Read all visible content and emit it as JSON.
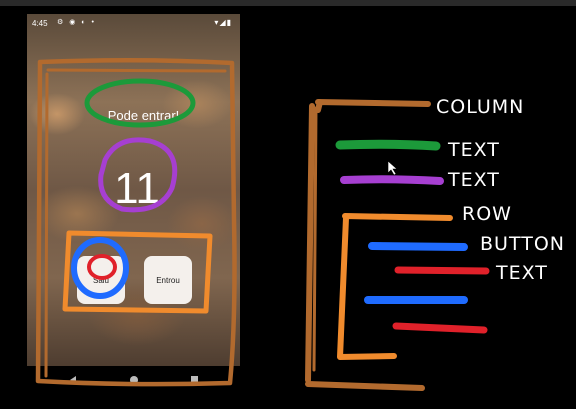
{
  "status_bar": {
    "time": "4:45"
  },
  "app": {
    "title": "Pode entrar!",
    "counter": "11",
    "buttons": {
      "left_label": "Saiu",
      "right_label": "Entrou"
    }
  },
  "annotations": {
    "labels": [
      "COLUMN",
      "TEXT",
      "TEXT",
      "ROW",
      "BUTTON",
      "TEXT"
    ],
    "colors": {
      "column": "#b26a2e",
      "text_green": "#1c9a3a",
      "text_purple": "#a63fd1",
      "row": "#f08b2d",
      "button": "#1f6bff",
      "text_red": "#e0212a"
    }
  },
  "nav": {
    "icons": [
      "back-icon",
      "home-icon",
      "recents-icon"
    ]
  }
}
